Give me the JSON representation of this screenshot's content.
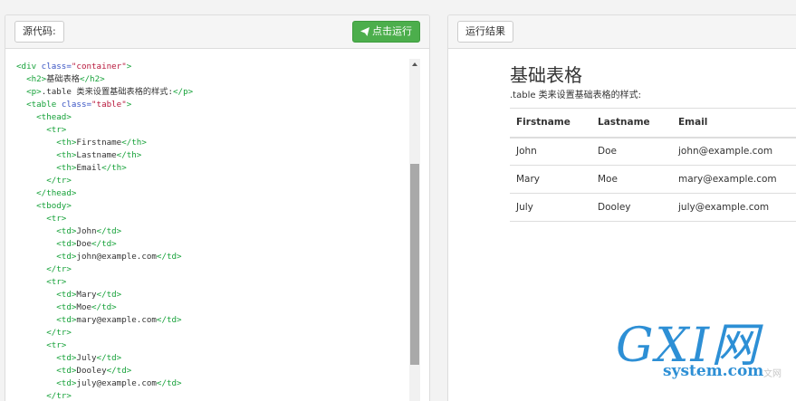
{
  "source_panel": {
    "label": "源代码:",
    "run_button_label": "点击运行"
  },
  "code_lines": [
    [
      {
        "t": "tg",
        "v": "<div "
      },
      {
        "t": "at",
        "v": "class="
      },
      {
        "t": "st",
        "v": "\"container\""
      },
      {
        "t": "tg",
        "v": ">"
      }
    ],
    [
      {
        "t": "x",
        "v": "  "
      },
      {
        "t": "tg",
        "v": "<h2>"
      },
      {
        "t": "x",
        "v": "基础表格"
      },
      {
        "t": "tg",
        "v": "</h2>"
      }
    ],
    [
      {
        "t": "x",
        "v": "  "
      },
      {
        "t": "tg",
        "v": "<p>"
      },
      {
        "t": "x",
        "v": ".table 类来设置基础表格的样式:"
      },
      {
        "t": "tg",
        "v": "</p>"
      }
    ],
    [
      {
        "t": "x",
        "v": "  "
      },
      {
        "t": "tg",
        "v": "<table "
      },
      {
        "t": "at",
        "v": "class="
      },
      {
        "t": "st",
        "v": "\"table\""
      },
      {
        "t": "tg",
        "v": ">"
      }
    ],
    [
      {
        "t": "x",
        "v": "    "
      },
      {
        "t": "tg",
        "v": "<thead>"
      }
    ],
    [
      {
        "t": "x",
        "v": "      "
      },
      {
        "t": "tg",
        "v": "<tr>"
      }
    ],
    [
      {
        "t": "x",
        "v": "        "
      },
      {
        "t": "tg",
        "v": "<th>"
      },
      {
        "t": "x",
        "v": "Firstname"
      },
      {
        "t": "tg",
        "v": "</th>"
      }
    ],
    [
      {
        "t": "x",
        "v": "        "
      },
      {
        "t": "tg",
        "v": "<th>"
      },
      {
        "t": "x",
        "v": "Lastname"
      },
      {
        "t": "tg",
        "v": "</th>"
      }
    ],
    [
      {
        "t": "x",
        "v": "        "
      },
      {
        "t": "tg",
        "v": "<th>"
      },
      {
        "t": "x",
        "v": "Email"
      },
      {
        "t": "tg",
        "v": "</th>"
      }
    ],
    [
      {
        "t": "x",
        "v": "      "
      },
      {
        "t": "tg",
        "v": "</tr>"
      }
    ],
    [
      {
        "t": "x",
        "v": "    "
      },
      {
        "t": "tg",
        "v": "</thead>"
      }
    ],
    [
      {
        "t": "x",
        "v": "    "
      },
      {
        "t": "tg",
        "v": "<tbody>"
      }
    ],
    [
      {
        "t": "x",
        "v": "      "
      },
      {
        "t": "tg",
        "v": "<tr>"
      }
    ],
    [
      {
        "t": "x",
        "v": "        "
      },
      {
        "t": "tg",
        "v": "<td>"
      },
      {
        "t": "x",
        "v": "John"
      },
      {
        "t": "tg",
        "v": "</td>"
      }
    ],
    [
      {
        "t": "x",
        "v": "        "
      },
      {
        "t": "tg",
        "v": "<td>"
      },
      {
        "t": "x",
        "v": "Doe"
      },
      {
        "t": "tg",
        "v": "</td>"
      }
    ],
    [
      {
        "t": "x",
        "v": "        "
      },
      {
        "t": "tg",
        "v": "<td>"
      },
      {
        "t": "x",
        "v": "john@example.com"
      },
      {
        "t": "tg",
        "v": "</td>"
      }
    ],
    [
      {
        "t": "x",
        "v": "      "
      },
      {
        "t": "tg",
        "v": "</tr>"
      }
    ],
    [
      {
        "t": "x",
        "v": "      "
      },
      {
        "t": "tg",
        "v": "<tr>"
      }
    ],
    [
      {
        "t": "x",
        "v": "        "
      },
      {
        "t": "tg",
        "v": "<td>"
      },
      {
        "t": "x",
        "v": "Mary"
      },
      {
        "t": "tg",
        "v": "</td>"
      }
    ],
    [
      {
        "t": "x",
        "v": "        "
      },
      {
        "t": "tg",
        "v": "<td>"
      },
      {
        "t": "x",
        "v": "Moe"
      },
      {
        "t": "tg",
        "v": "</td>"
      }
    ],
    [
      {
        "t": "x",
        "v": "        "
      },
      {
        "t": "tg",
        "v": "<td>"
      },
      {
        "t": "x",
        "v": "mary@example.com"
      },
      {
        "t": "tg",
        "v": "</td>"
      }
    ],
    [
      {
        "t": "x",
        "v": "      "
      },
      {
        "t": "tg",
        "v": "</tr>"
      }
    ],
    [
      {
        "t": "x",
        "v": "      "
      },
      {
        "t": "tg",
        "v": "<tr>"
      }
    ],
    [
      {
        "t": "x",
        "v": "        "
      },
      {
        "t": "tg",
        "v": "<td>"
      },
      {
        "t": "x",
        "v": "July"
      },
      {
        "t": "tg",
        "v": "</td>"
      }
    ],
    [
      {
        "t": "x",
        "v": "        "
      },
      {
        "t": "tg",
        "v": "<td>"
      },
      {
        "t": "x",
        "v": "Dooley"
      },
      {
        "t": "tg",
        "v": "</td>"
      }
    ],
    [
      {
        "t": "x",
        "v": "        "
      },
      {
        "t": "tg",
        "v": "<td>"
      },
      {
        "t": "x",
        "v": "july@example.com"
      },
      {
        "t": "tg",
        "v": "</td>"
      }
    ],
    [
      {
        "t": "x",
        "v": "      "
      },
      {
        "t": "tg",
        "v": "</tr>"
      }
    ]
  ],
  "result_panel": {
    "label": "运行结果",
    "heading": "基础表格",
    "paragraph": ".table 类来设置基础表格的样式:",
    "table": {
      "headers": [
        "Firstname",
        "Lastname",
        "Email"
      ],
      "rows": [
        [
          "John",
          "Doe",
          "john@example.com"
        ],
        [
          "Mary",
          "Moe",
          "mary@example.com"
        ],
        [
          "July",
          "Dooley",
          "july@example.com"
        ]
      ]
    }
  },
  "watermark": {
    "main": "GXI网",
    "sub": "system.com",
    "tail": "文网"
  },
  "colors": {
    "run_button": "#4cae4c",
    "code_tag": "#17a23a",
    "code_attr": "#3a55c4",
    "code_string": "#b8183c",
    "watermark": "#2d8fd5"
  }
}
